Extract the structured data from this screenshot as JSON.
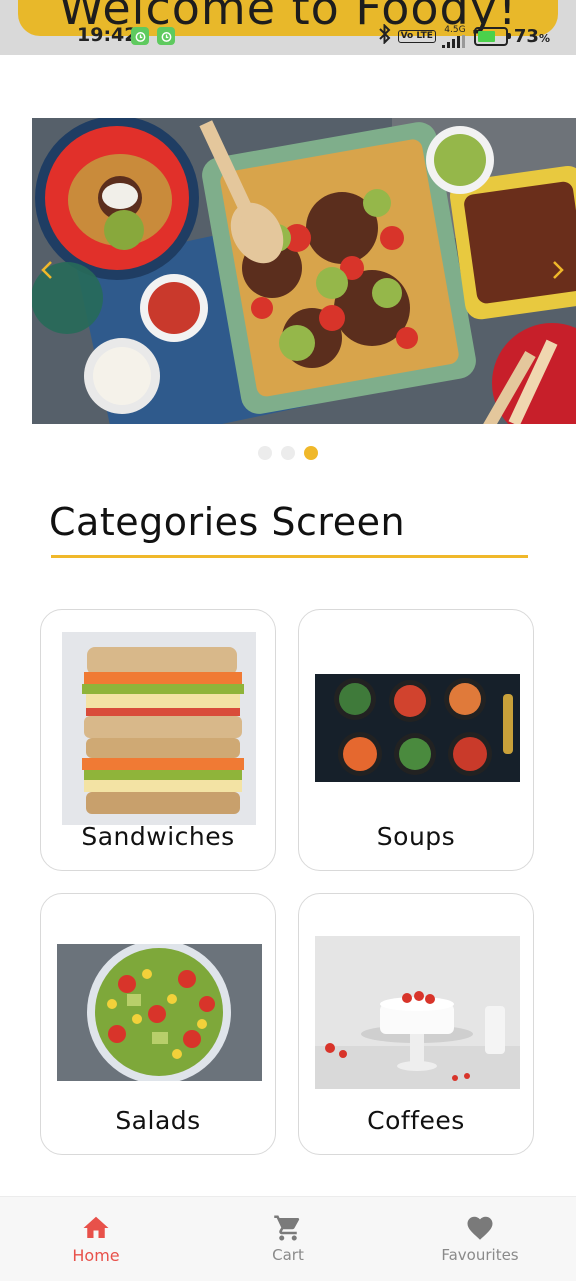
{
  "app": {
    "welcome": "Welcome to Foody!"
  },
  "status_bar": {
    "time": "19:42",
    "network": "4.5G",
    "volte": "Vo LTE",
    "battery": "73",
    "battery_unit": "%"
  },
  "carousel": {
    "slide_count": 3,
    "active_index": 2
  },
  "page": {
    "title": "Categories Screen"
  },
  "categories": [
    {
      "label": "Sandwiches"
    },
    {
      "label": "Soups"
    },
    {
      "label": "Salads"
    },
    {
      "label": "Coffees"
    }
  ],
  "nav": [
    {
      "label": "Home",
      "icon": "home-icon",
      "active": true
    },
    {
      "label": "Cart",
      "icon": "cart-icon",
      "active": false
    },
    {
      "label": "Favourites",
      "icon": "heart-icon",
      "active": false
    }
  ],
  "colors": {
    "accent": "#f0b82a",
    "active_nav": "#e8514a",
    "inactive_nav": "#8a8a8a"
  }
}
